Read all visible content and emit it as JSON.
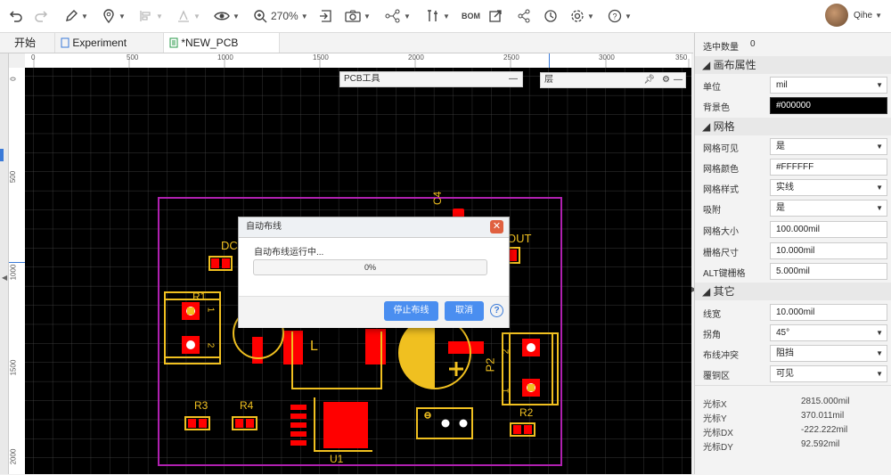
{
  "toolbar": {
    "zoom": "270%",
    "bom": "BOM",
    "user_name": "Qihe"
  },
  "tabs": [
    {
      "label": "开始"
    },
    {
      "label": "Experiment"
    },
    {
      "label": "*NEW_PCB"
    }
  ],
  "ruler": {
    "top_ticks": [
      "0",
      "500",
      "1000",
      "1500",
      "2000",
      "2500",
      "3000",
      "350"
    ],
    "left_ticks": [
      "0",
      "500",
      "1000",
      "1500",
      "2000"
    ]
  },
  "floating": {
    "pcb_tools": "PCB工具",
    "layers": "层"
  },
  "board_labels": {
    "dc": "DC",
    "c4": "C4",
    "out": "OUT",
    "r1": "R1",
    "r1_pin1": "1",
    "r1_pin2": "2",
    "l": "L",
    "p2": "P2",
    "p2_pin1": "1",
    "p2_pin2": "2",
    "r3": "R3",
    "r4": "R4",
    "r2": "R2",
    "u1": "U1",
    "plus": "+"
  },
  "dialog": {
    "title": "自动布线",
    "message": "自动布线运行中...",
    "progress_text": "0%",
    "progress_value": 0,
    "stop_label": "停止布线",
    "cancel_label": "取消",
    "help": "?"
  },
  "rightpanel": {
    "selected_count_label": "选中数量",
    "selected_count": "0",
    "canvas_section": "画布属性",
    "unit_label": "单位",
    "unit_value": "mil",
    "bg_label": "背景色",
    "bg_value": "#000000",
    "grid_section": "网格",
    "grid_visible_label": "网格可见",
    "grid_visible_value": "是",
    "grid_color_label": "网格颜色",
    "grid_color_value": "#FFFFFF",
    "grid_style_label": "网格样式",
    "grid_style_value": "实线",
    "snap_label": "吸附",
    "snap_value": "是",
    "grid_size_label": "网格大小",
    "grid_size_value": "100.000mil",
    "snap_size_label": "栅格尺寸",
    "snap_size_value": "10.000mil",
    "alt_snap_label": "ALT键栅格",
    "alt_snap_value": "5.000mil",
    "other_section": "其它",
    "line_width_label": "线宽",
    "line_width_value": "10.000mil",
    "corner_label": "拐角",
    "corner_value": "45°",
    "conflict_label": "布线冲突",
    "conflict_value": "阻挡",
    "copper_label": "覆铜区",
    "copper_value": "可见",
    "cursor_x_label": "光标X",
    "cursor_x_value": "2815.000mil",
    "cursor_y_label": "光标Y",
    "cursor_y_value": "370.011mil",
    "cursor_dx_label": "光标DX",
    "cursor_dx_value": "-222.222mil",
    "cursor_dy_label": "光标DY",
    "cursor_dy_value": "92.592mil"
  },
  "colors": {
    "board_outline": "#b020b0",
    "silkscreen": "#f0c020",
    "pad": "#ff0000",
    "canvas_bg": "#000000",
    "accent": "#4a8ef0"
  }
}
